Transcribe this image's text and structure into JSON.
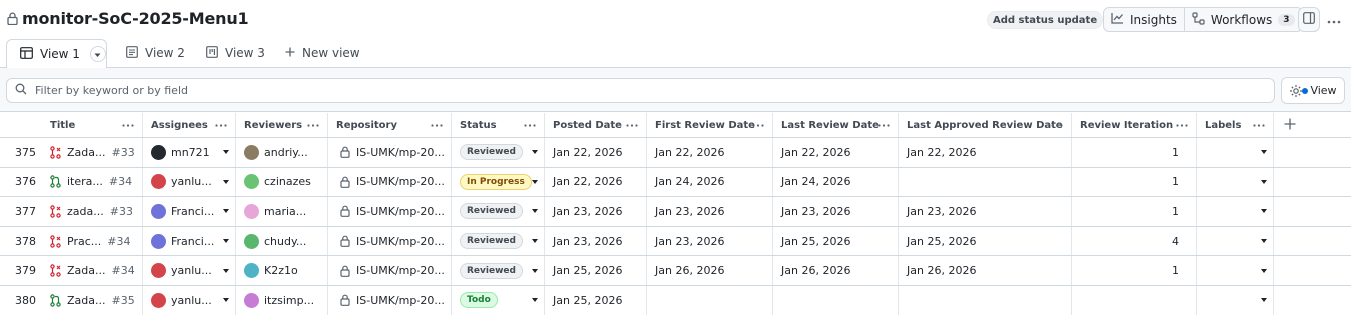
{
  "header": {
    "title": "monitor-SoC-2025-Menu1",
    "status_update_label": "Add status update",
    "insights_label": "Insights",
    "workflows_label": "Workflows",
    "workflows_count": "3"
  },
  "tabs": [
    {
      "label": "View 1",
      "active": true
    },
    {
      "label": "View 2",
      "active": false
    },
    {
      "label": "View 3",
      "active": false
    }
  ],
  "new_view_label": "New view",
  "filter": {
    "placeholder": "Filter by keyword or by field",
    "value": ""
  },
  "view_button_label": "View",
  "table": {
    "columns": [
      "Title",
      "Assignees",
      "Reviewers",
      "Repository",
      "Status",
      "Posted Date",
      "First Review Date",
      "Last Review Date",
      "Last Approved Review Date",
      "Review Iteration",
      "Labels"
    ],
    "rows": [
      {
        "num": "375",
        "pr_state": "closed",
        "title": "Zada...",
        "issue": "#33",
        "assignee": "mn721",
        "assignee_avatar": "#24292f",
        "reviewer": "andriy...",
        "reviewer_avatar": "#8c7b63",
        "repo": "IS-UMK/mp-20...",
        "status": "Reviewed",
        "posted": "Jan 22, 2026",
        "first_review": "Jan 22, 2026",
        "last_review": "Jan 22, 2026",
        "last_approved": "Jan 22, 2026",
        "iteration": "1",
        "labels": ""
      },
      {
        "num": "376",
        "pr_state": "open",
        "title": "itera...",
        "issue": "#34",
        "assignee": "yanlu...",
        "assignee_avatar": "#d4454b",
        "reviewer": "czinazes",
        "reviewer_avatar": "#69c372",
        "repo": "IS-UMK/mp-20...",
        "status": "In Progress",
        "posted": "Jan 22, 2026",
        "first_review": "Jan 24, 2026",
        "last_review": "Jan 24, 2026",
        "last_approved": "",
        "iteration": "1",
        "labels": ""
      },
      {
        "num": "377",
        "pr_state": "closed",
        "title": "zada...",
        "issue": "#33",
        "assignee": "Franci...",
        "assignee_avatar": "#6f72d8",
        "reviewer": "maria...",
        "reviewer_avatar": "#e6a6d8",
        "repo": "IS-UMK/mp-20...",
        "status": "Reviewed",
        "posted": "Jan 23, 2026",
        "first_review": "Jan 23, 2026",
        "last_review": "Jan 23, 2026",
        "last_approved": "Jan 23, 2026",
        "iteration": "1",
        "labels": ""
      },
      {
        "num": "378",
        "pr_state": "closed",
        "title": "Prac...",
        "issue": "#34",
        "assignee": "Franci...",
        "assignee_avatar": "#6f72d8",
        "reviewer": "chudy...",
        "reviewer_avatar": "#59b66a",
        "repo": "IS-UMK/mp-20...",
        "status": "Reviewed",
        "posted": "Jan 23, 2026",
        "first_review": "Jan 23, 2026",
        "last_review": "Jan 25, 2026",
        "last_approved": "Jan 25, 2026",
        "iteration": "4",
        "labels": ""
      },
      {
        "num": "379",
        "pr_state": "closed",
        "title": "Zada...",
        "issue": "#34",
        "assignee": "yanlu...",
        "assignee_avatar": "#d4454b",
        "reviewer": "K2z1o",
        "reviewer_avatar": "#4fb3c6",
        "repo": "IS-UMK/mp-20...",
        "status": "Reviewed",
        "posted": "Jan 25, 2026",
        "first_review": "Jan 26, 2026",
        "last_review": "Jan 26, 2026",
        "last_approved": "Jan 26, 2026",
        "iteration": "1",
        "labels": ""
      },
      {
        "num": "380",
        "pr_state": "open",
        "title": "Zada...",
        "issue": "#35",
        "assignee": "yanlu...",
        "assignee_avatar": "#d4454b",
        "reviewer": "itzsimp...",
        "reviewer_avatar": "#c67bd4",
        "repo": "IS-UMK/mp-20...",
        "status": "Todo",
        "posted": "Jan 25, 2026",
        "first_review": "",
        "last_review": "",
        "last_approved": "",
        "iteration": "",
        "labels": ""
      }
    ]
  }
}
